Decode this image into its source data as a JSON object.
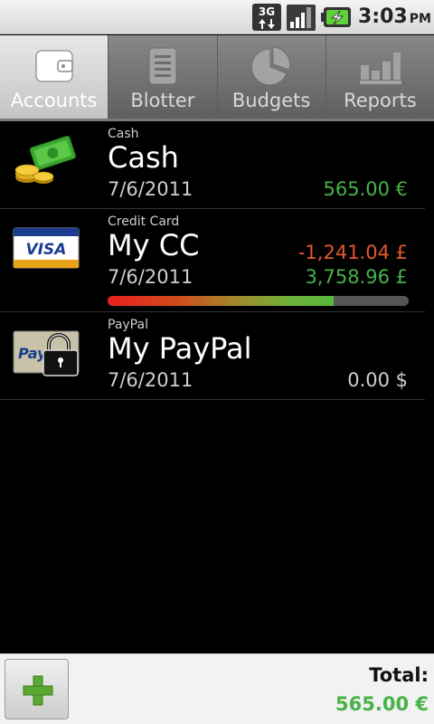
{
  "status_bar": {
    "network": "3G",
    "time": "3:03",
    "ampm": "PM",
    "icons": [
      "3g-icon",
      "signal-icon",
      "battery-charging-icon"
    ]
  },
  "tabs": [
    {
      "label": "Accounts",
      "icon": "wallet-icon",
      "active": true
    },
    {
      "label": "Blotter",
      "icon": "list-icon",
      "active": false
    },
    {
      "label": "Budgets",
      "icon": "pie-chart-icon",
      "active": false
    },
    {
      "label": "Reports",
      "icon": "bar-chart-icon",
      "active": false
    }
  ],
  "accounts": [
    {
      "type": "Cash",
      "name": "Cash",
      "date": "7/6/2011",
      "amount": "565.00 €",
      "amount_color": "#47b247",
      "icon": "cash-icon"
    },
    {
      "type": "Credit Card",
      "name": "My CC",
      "date": "7/6/2011",
      "balance": "-1,241.04 £",
      "balance_color": "#e4582c",
      "available": "3,758.96 £",
      "available_color": "#47b247",
      "limit_used_fraction": 0.75,
      "icon": "visa-card-icon",
      "card_text": "VISA"
    },
    {
      "type": "PayPal",
      "name": "My PayPal",
      "date": "7/6/2011",
      "amount": "0.00 $",
      "amount_color": "#cfcfcf",
      "icon": "paypal-locked-icon",
      "logo_text": "Pay"
    }
  ],
  "bottom": {
    "add_icon": "plus-icon",
    "total_label": "Total:",
    "total_value": "565.00 €"
  },
  "colors": {
    "positive": "#47b247",
    "negative": "#e4582c",
    "active_tab": "#d6d6d6"
  }
}
